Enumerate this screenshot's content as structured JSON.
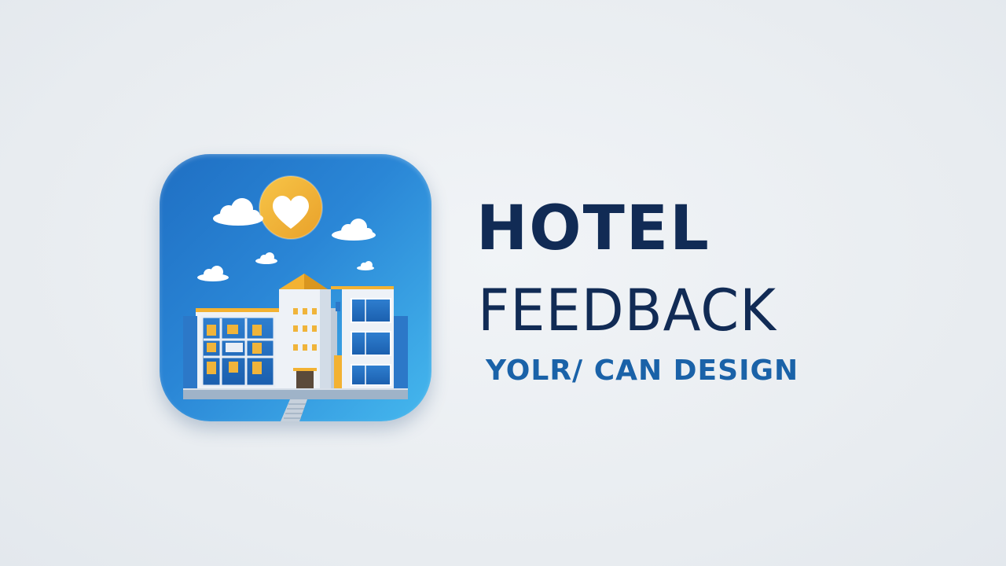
{
  "logo": {
    "icon": "hotel-building-icon",
    "accents": [
      "heart-icon",
      "sun-icon",
      "cloud-icon"
    ],
    "colors": {
      "tile_dark": "#1f6fc3",
      "tile_light": "#45b8ee",
      "accent_yellow": "#f3b232",
      "building_white": "#eef2f7"
    }
  },
  "title": {
    "line1": "HOTEL",
    "line2": "FEEDBACK",
    "tagline": "YOLR/ CAN DESIGN"
  },
  "colors": {
    "title_text": "#112b55",
    "tagline_text": "#1a62a8",
    "background": "#e8ecf0"
  }
}
